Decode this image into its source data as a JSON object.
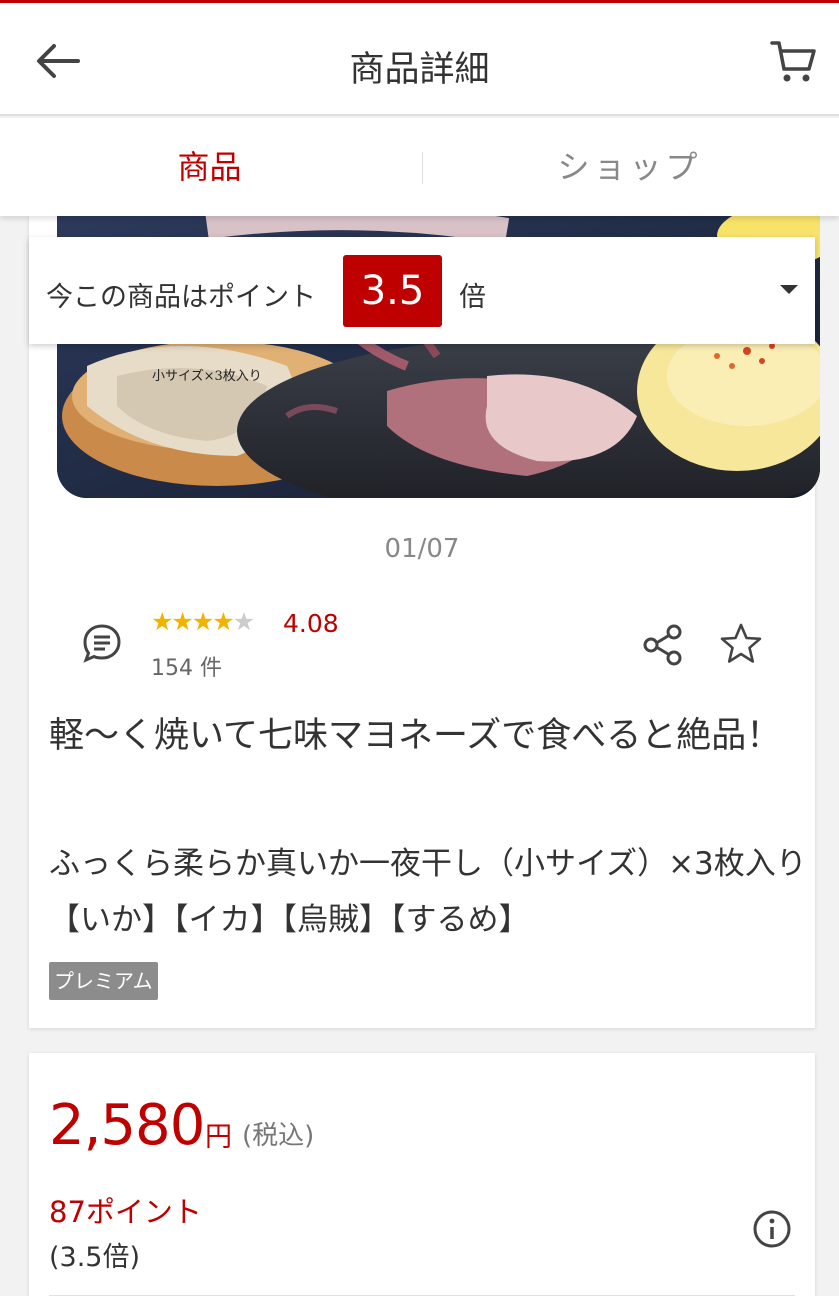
{
  "header": {
    "title": "商品詳細"
  },
  "tabs": [
    {
      "label": "商品"
    },
    {
      "label": "ショップ"
    }
  ],
  "points_banner": {
    "prefix": "今この商品はポイント",
    "badge": "3.5",
    "suffix": "倍"
  },
  "image": {
    "caption": "小サイズ×3枚入り",
    "counter": "01/07"
  },
  "rating": {
    "stars": 4,
    "max_stars": 5,
    "score": "4.08",
    "count": "154 件"
  },
  "product": {
    "catch_copy": "軽〜く焼いて七味マヨネーズで食べると絶品！",
    "name": "ふっくら柔らか真いか一夜干し（小サイズ）×3枚入り【いか】【イカ】【烏賊】【するめ】",
    "tag": "プレミアム"
  },
  "price": {
    "amount": "2,580",
    "unit": "円",
    "tax": "(税込)",
    "points": "87ポイント",
    "multiplier": "(3.5倍)"
  },
  "colors": {
    "brand": "#bf0000",
    "star": "#f0b400",
    "tag": "#8c8c8c"
  },
  "icons": [
    "back-arrow-icon",
    "cart-icon",
    "review-bubble-icon",
    "share-icon",
    "star-outline-icon",
    "info-icon",
    "caret-down-icon"
  ]
}
